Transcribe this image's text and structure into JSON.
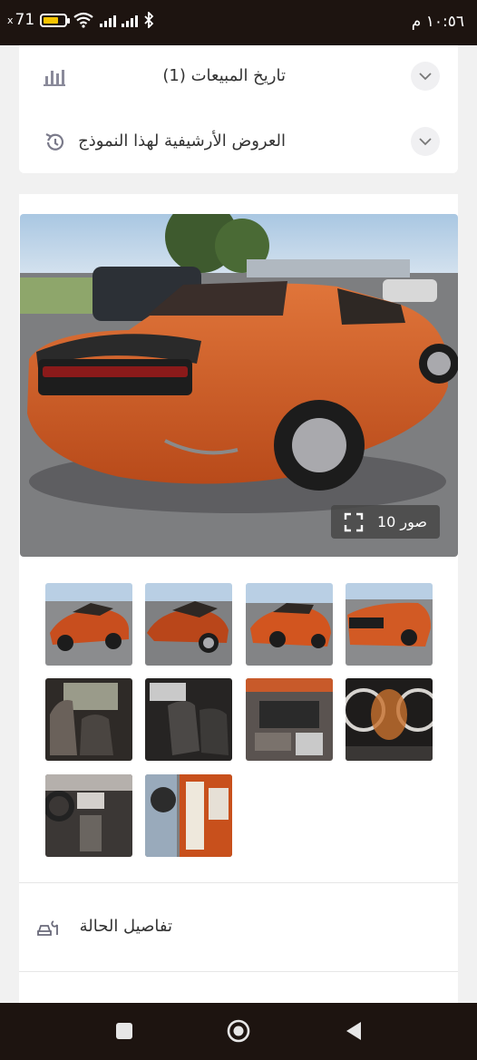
{
  "status_bar": {
    "time": "١٠:٥٦ م",
    "battery": "71",
    "battery_level": 0.71
  },
  "sections": {
    "sales_history": "تاريخ المبيعات (1)",
    "archived_offers": "العروض الأرشيفية لهذا النموذج",
    "condition_details": "تفاصيل الحالة"
  },
  "gallery": {
    "photos_label": "صور 10",
    "thumbnails": [
      "front-left-damage",
      "front-right-damage",
      "left-side",
      "rear",
      "driver-seat",
      "rear-seats",
      "engine-bay",
      "instrument-cluster",
      "dashboard",
      "door-jamb-label"
    ]
  },
  "colors": {
    "status_bar": "#1d1410",
    "background": "#f1f1f1",
    "card": "#ffffff",
    "car_orange": "#d2551f"
  },
  "icons": {
    "sales_history": "bar-chart-icon",
    "archived_offers": "history-icon",
    "condition": "car-wrench-icon",
    "expand": "chevron-down-icon",
    "fullscreen": "fullscreen-icon"
  }
}
